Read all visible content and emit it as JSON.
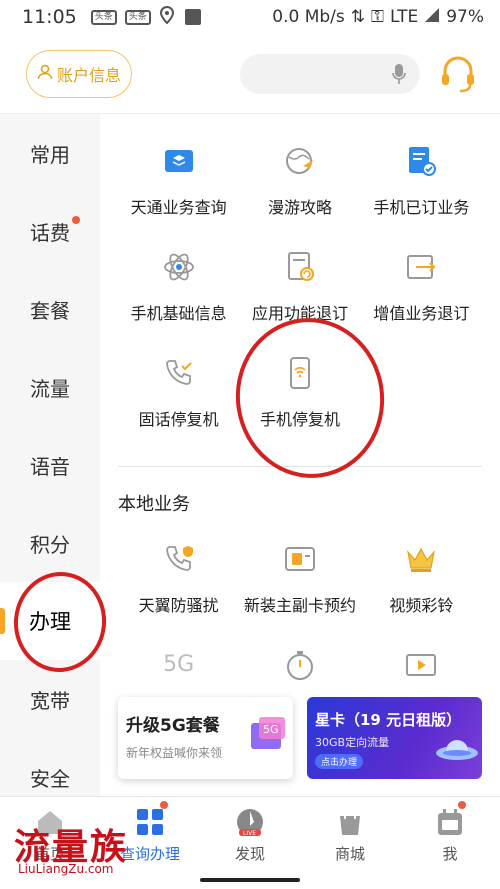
{
  "status": {
    "time": "11:05",
    "badge1": "头条",
    "badge2": "头条",
    "speed": "0.0 Mb/s",
    "network": "LTE",
    "battery": "97%"
  },
  "header": {
    "account_label": "账户信息",
    "search_placeholder": ""
  },
  "sidebar": {
    "items": [
      {
        "label": "常用"
      },
      {
        "label": "话费"
      },
      {
        "label": "套餐"
      },
      {
        "label": "流量"
      },
      {
        "label": "语音"
      },
      {
        "label": "积分"
      },
      {
        "label": "办理"
      },
      {
        "label": "宽带"
      },
      {
        "label": "安全"
      }
    ]
  },
  "services": [
    {
      "label": "天通业务查询",
      "icon": "satellite-card-icon"
    },
    {
      "label": "漫游攻略",
      "icon": "globe-plane-icon"
    },
    {
      "label": "手机已订业务",
      "icon": "document-check-icon"
    },
    {
      "label": "手机基础信息",
      "icon": "atom-icon"
    },
    {
      "label": "应用功能退订",
      "icon": "document-refresh-icon"
    },
    {
      "label": "增值业务退订",
      "icon": "box-arrow-icon"
    },
    {
      "label": "固话停复机",
      "icon": "phone-check-icon"
    },
    {
      "label": "手机停复机",
      "icon": "mobile-signal-icon"
    }
  ],
  "local": {
    "title": "本地业务",
    "items": [
      {
        "label": "天翼防骚扰",
        "icon": "phone-shield-icon"
      },
      {
        "label": "新装主副卡预约",
        "icon": "sim-card-icon"
      },
      {
        "label": "视频彩铃",
        "icon": "crown-icon"
      },
      {
        "label": "",
        "icon": "5g-icon"
      },
      {
        "label": "",
        "icon": "timer-icon"
      },
      {
        "label": "",
        "icon": "video-play-icon"
      }
    ]
  },
  "promo": {
    "left": {
      "title": "升级5G套餐",
      "subtitle": "新年权益喊你来领"
    },
    "right": {
      "title": "星卡（19 元日租版）",
      "subtitle": "30GB定向流量",
      "button": "点击办理"
    }
  },
  "tabs": [
    {
      "label": "首页"
    },
    {
      "label": "查询办理"
    },
    {
      "label": "发现"
    },
    {
      "label": "商城"
    },
    {
      "label": "我"
    }
  ],
  "watermark": {
    "text": "流量族",
    "sub": "LiuLiangZu.com"
  },
  "colors": {
    "accent": "#f5a623",
    "blue": "#2b6fe0",
    "red_mark": "#d62020"
  }
}
